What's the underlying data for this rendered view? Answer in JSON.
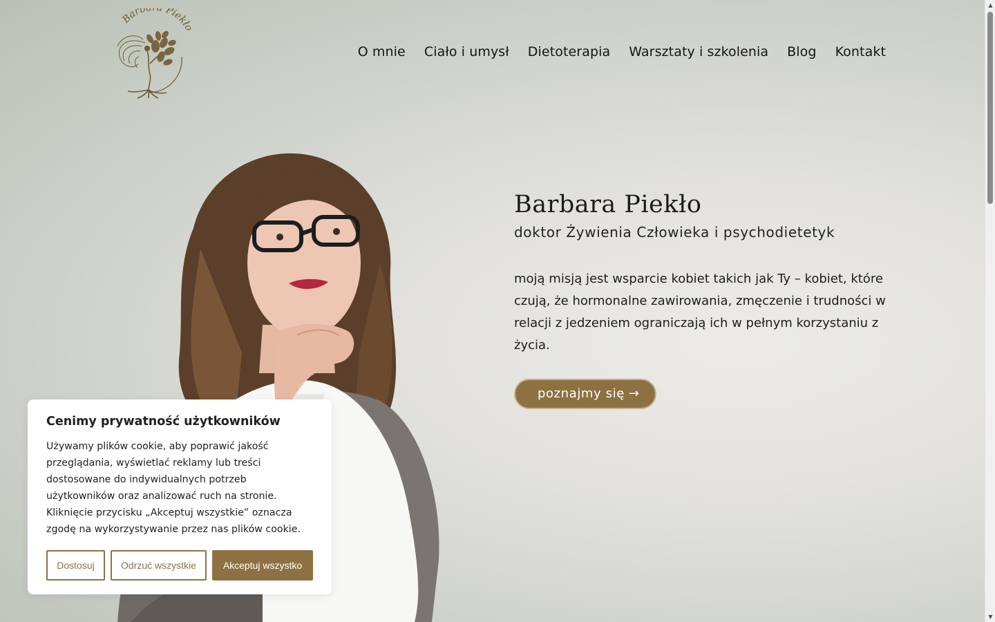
{
  "header": {
    "logo_text": "Barbara Piekło",
    "nav": [
      "O mnie",
      "Ciało i umysł",
      "Dietoterapia",
      "Warsztaty i szkolenia",
      "Blog",
      "Kontakt"
    ]
  },
  "hero": {
    "name": "Barbara Piekło",
    "subtitle": "doktor Żywienia Człowieka i psychodietetyk",
    "description": "moją misją jest wsparcie kobiet takich jak Ty – kobiet, które czują, że hormonalne zawirowania, zmęczenie i trudności w relacji z jedzeniem ograniczają ich w pełnym korzystaniu z życia.",
    "cta_label": "poznajmy się",
    "cta_arrow": "→"
  },
  "cookie": {
    "title": "Cenimy prywatność użytkowników",
    "text": "Używamy plików cookie, aby poprawić jakość przeglądania, wyświetlać reklamy lub treści dostosowane do indywidualnych potrzeb użytkowników oraz analizować ruch na stronie. Kliknięcie przycisku „Akceptuj wszystkie” oznacza zgodę na wykorzystywanie przez nas plików cookie.",
    "customize_label": "Dostosuj",
    "reject_label": "Odrzuć wszystkie",
    "accept_label": "Akceptuj wszystko"
  },
  "colors": {
    "accent": "#8e7143",
    "text": "#1b1b1b"
  }
}
